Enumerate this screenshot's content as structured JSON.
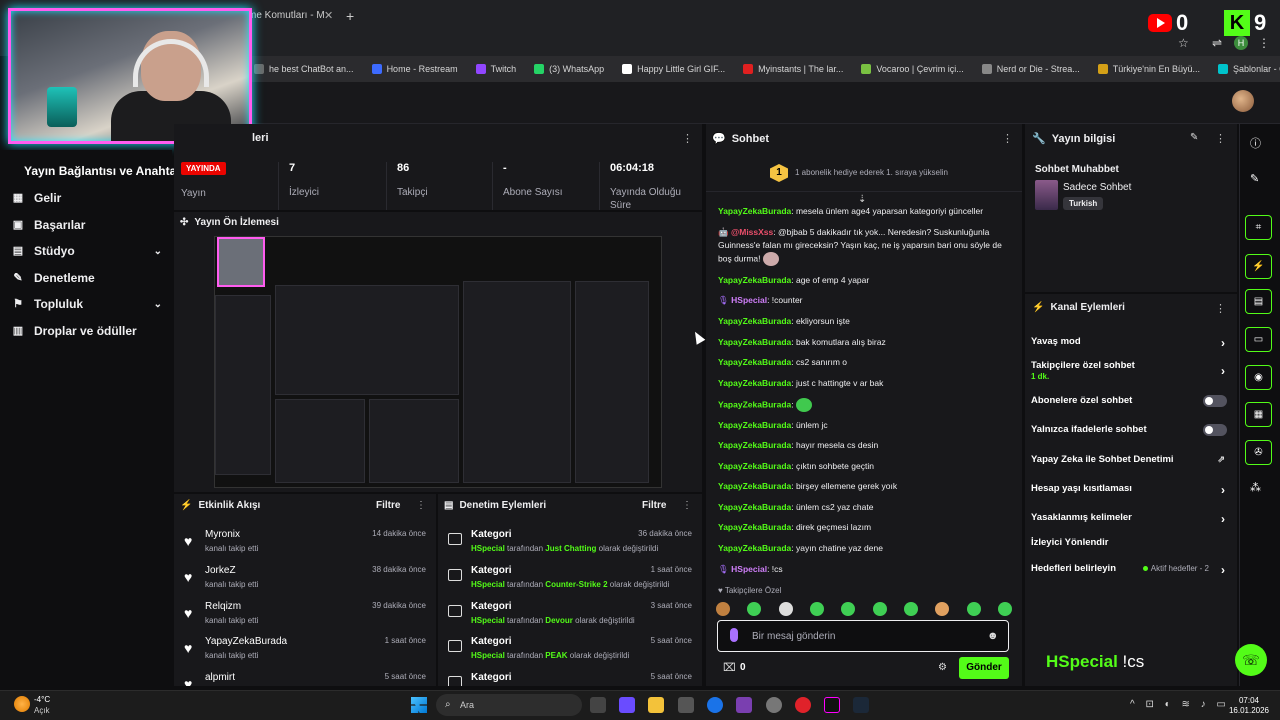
{
  "browser": {
    "tab_title": "me Komutları - M",
    "tab_close": "✕",
    "new_tab": "+",
    "bookmarks": [
      {
        "label": "he best ChatBot an...",
        "color": "#6a6a6a"
      },
      {
        "label": "Home - Restream",
        "color": "#3d6bff"
      },
      {
        "label": "Twitch",
        "color": "#9146ff"
      },
      {
        "label": "(3) WhatsApp",
        "color": "#25d366"
      },
      {
        "label": "Happy Little Girl GIF...",
        "color": "#ffffff"
      },
      {
        "label": "Myinstants | The lar...",
        "color": "#e02020"
      },
      {
        "label": "Vocaroo | Çevrim içi...",
        "color": "#7ac142"
      },
      {
        "label": "Nerd or Die - Strea...",
        "color": "#888888"
      },
      {
        "label": "Türkiye'nin En Büyü...",
        "color": "#d4a017"
      },
      {
        "label": "Şablonlar - Canva",
        "color": "#00c4cc"
      }
    ]
  },
  "overlay": {
    "youtube_count": "0",
    "kick_logo": "K",
    "kick_count": "9",
    "profile_letter": "H"
  },
  "sidebar": {
    "title": "Yayın Bağlantısı ve Anahtarı",
    "items": [
      {
        "label": "Gelir",
        "icon": "▦",
        "chevron": ""
      },
      {
        "label": "Başarılar",
        "icon": "▣",
        "chevron": ""
      },
      {
        "label": "Stüdyo",
        "icon": "▤",
        "chevron": "⌄"
      },
      {
        "label": "Denetleme",
        "icon": "✎",
        "chevron": ""
      },
      {
        "label": "Topluluk",
        "icon": "⚑",
        "chevron": "⌄"
      },
      {
        "label": "Droplar ve ödüller",
        "icon": "▥",
        "chevron": ""
      }
    ]
  },
  "stats": {
    "title": "leri",
    "live_badge": "YAYINDA",
    "live_label": "Yayın",
    "cols": [
      {
        "value": "7",
        "label": "İzleyici"
      },
      {
        "value": "86",
        "label": "Takipçi"
      },
      {
        "value": "-",
        "label": "Abone Sayısı"
      },
      {
        "value": "06:04:18",
        "label": "Yayında Olduğu Süre"
      }
    ]
  },
  "preview": {
    "title": "Yayın Ön İzlemesi"
  },
  "activity": {
    "title": "Etkinlik Akışı",
    "filter": "Filtre",
    "rows": [
      {
        "name": "Myronix",
        "sub": "kanalı takip etti",
        "time": "14 dakika önce"
      },
      {
        "name": "JorkeZ",
        "sub": "kanalı takip etti",
        "time": "38 dakika önce"
      },
      {
        "name": "Relqizm",
        "sub": "kanalı takip etti",
        "time": "39 dakika önce"
      },
      {
        "name": "YapayZekaBurada",
        "sub": "kanalı takip etti",
        "time": "1 saat önce"
      },
      {
        "name": "alpmirt",
        "sub": "",
        "time": "5 saat önce"
      }
    ]
  },
  "moderation": {
    "title": "Denetim Eylemleri",
    "filter": "Filtre",
    "rows": [
      {
        "name": "Kategori",
        "actor": "HSpecial",
        "mid": "tarafından",
        "target": "Just Chatting",
        "end": "olarak değiştirildi",
        "time": "36 dakika önce"
      },
      {
        "name": "Kategori",
        "actor": "HSpecial",
        "mid": "tarafından",
        "target": "Counter-Strike 2",
        "end": "olarak değiştirildi",
        "time": "1 saat önce"
      },
      {
        "name": "Kategori",
        "actor": "HSpecial",
        "mid": "tarafından",
        "target": "Devour",
        "end": "olarak değiştirildi",
        "time": "3 saat önce"
      },
      {
        "name": "Kategori",
        "actor": "HSpecial",
        "mid": "tarafından",
        "target": "PEAK",
        "end": "olarak değiştirildi",
        "time": "5 saat önce"
      },
      {
        "name": "Kategori",
        "actor": "",
        "mid": "",
        "target": "",
        "end": "",
        "time": "5 saat önce"
      }
    ]
  },
  "chat": {
    "title": "Sohbet",
    "banner": "1 abonelik hediye ederek 1. sıraya yükselin",
    "banner_badge": "1",
    "messages": [
      {
        "user": "YapayZekaBurada",
        "text": "mesela ünlem age4 yaparsan kategoriyi günceller"
      },
      {
        "user": "",
        "mention": "@MissXss",
        "text": ": @bjbab 5 dakikadır tık yok... Neredesin? Suskunluğunla Guinness'e falan mı gireceksin? Yaşın kaç, ne iş yaparsın bari onu söyle de boş durma!"
      },
      {
        "user": "YapayZekaBurada",
        "text": "age of emp 4 yapar"
      },
      {
        "user2": "HSpecial",
        "text": "!counter"
      },
      {
        "user": "YapayZekaBurada",
        "text": "ekliyorsun işte"
      },
      {
        "user": "YapayZekaBurada",
        "text": "bak komutlara alış biraz"
      },
      {
        "user": "YapayZekaBurada",
        "text": "cs2 sanırım o"
      },
      {
        "user": "YapayZekaBurada",
        "text": "just c hattingte v ar bak"
      },
      {
        "user": "YapayZekaBurada",
        "text": ""
      },
      {
        "user": "YapayZekaBurada",
        "text": "ünlem jc"
      },
      {
        "user": "YapayZekaBurada",
        "text": "hayır mesela cs desin"
      },
      {
        "user": "YapayZekaBurada",
        "text": "çıktın sohbete geçtin"
      },
      {
        "user": "YapayZekaBurada",
        "text": "birşey ellemene gerek yoık"
      },
      {
        "user": "YapayZekaBurada",
        "text": "ünlem cs2 yaz chate"
      },
      {
        "user": "YapayZekaBurada",
        "text": "direk geçmesi lazım"
      },
      {
        "user": "YapayZekaBurada",
        "text": "yayın chatine yaz dene"
      },
      {
        "user2": "HSpecial",
        "text": "!cs"
      }
    ],
    "followers_only": "Takipçilere Özel",
    "input_placeholder": "Bir mesaj gönderin",
    "gift_count": "0",
    "send": "Gönder"
  },
  "info": {
    "title": "Yayın bilgisi",
    "stream_name": "Sohbet Muhabbet",
    "category": "Sadece Sohbet",
    "tag": "Turkish"
  },
  "channel": {
    "title": "Kanal Eylemleri",
    "rows": [
      {
        "label": "Yavaş mod",
        "kind": "chevron",
        "sub": ""
      },
      {
        "label": "Takipçilere özel sohbet",
        "kind": "chevron",
        "sub": "1 dk."
      },
      {
        "label": "Abonelere özel sohbet",
        "kind": "toggle",
        "sub": ""
      },
      {
        "label": "Yalnızca ifadelerle sohbet",
        "kind": "toggle",
        "sub": ""
      },
      {
        "label": "Yapay Zeka ile Sohbet Denetimi",
        "kind": "external",
        "sub": ""
      },
      {
        "label": "Hesap yaşı kısıtlaması",
        "kind": "chevron",
        "sub": ""
      },
      {
        "label": "Yasaklanmış kelimeler",
        "kind": "chevron",
        "sub": ""
      },
      {
        "label": "İzleyici Yönlendir",
        "kind": "none",
        "sub": ""
      },
      {
        "label": "Hedefleri belirleyin",
        "kind": "chevron",
        "sub": ""
      }
    ],
    "goal_status": "Aktif hedefler - 2"
  },
  "screen_overlay": {
    "name": "HSpecial",
    "cmd": "!cs"
  },
  "taskbar": {
    "temp": "-4°C",
    "weather": "Açık",
    "search": "Ara",
    "time": "07:04",
    "date": "16.01.2026"
  }
}
